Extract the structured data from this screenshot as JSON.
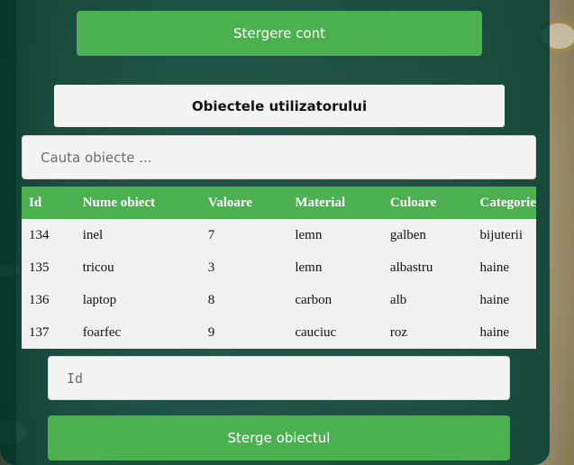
{
  "account": {
    "delete_label": "Stergere cont"
  },
  "objects_title": "Obiectele utilizatorului",
  "search": {
    "placeholder": "Cauta obiecte ..."
  },
  "table": {
    "headers": [
      "Id",
      "Nume obiect",
      "Valoare",
      "Material",
      "Culoare",
      "Categorie"
    ],
    "rows": [
      [
        "134",
        "inel",
        "7",
        "lemn",
        "galben",
        "bijuterii"
      ],
      [
        "135",
        "tricou",
        "3",
        "lemn",
        "albastru",
        "haine"
      ],
      [
        "136",
        "laptop",
        "8",
        "carbon",
        "alb",
        "haine"
      ],
      [
        "137",
        "foarfec",
        "9",
        "cauciuc",
        "roz",
        "haine"
      ]
    ]
  },
  "id_field": {
    "placeholder": "Id"
  },
  "delete_object_label": "Sterge obiectul",
  "colors": {
    "panel": "#003c32",
    "accent": "#4caf50",
    "field_bg": "#f3f3f3"
  }
}
